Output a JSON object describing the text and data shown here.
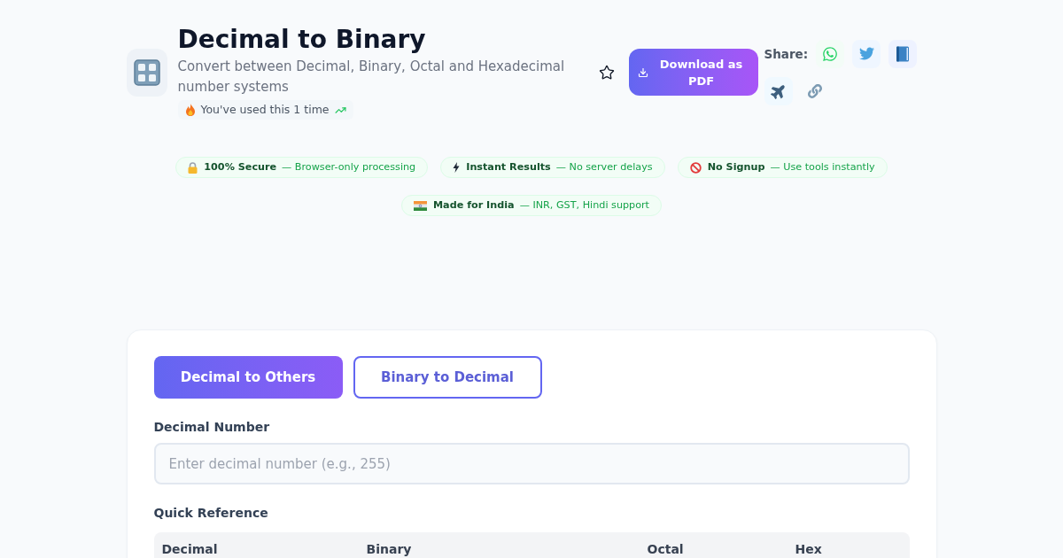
{
  "header": {
    "title": "Decimal to Binary",
    "subtitle": "Convert between Decimal, Binary, Octal and Hexadecimal number systems",
    "usage": "You've used this 1 time",
    "favorited": false,
    "download_button": "Download as PDF"
  },
  "share": {
    "label": "Share:"
  },
  "trust_badges": [
    {
      "title": "100% Secure",
      "description": "— Browser-only processing"
    },
    {
      "title": "Instant Results",
      "description": "— No server delays"
    },
    {
      "title": "No Signup",
      "description": "— Use tools instantly"
    },
    {
      "title": "Made for India",
      "description": "— INR, GST, Hindi support"
    }
  ],
  "converter": {
    "tabs": [
      {
        "label": "Decimal to Others",
        "selected": true
      },
      {
        "label": "Binary to Decimal",
        "selected": false
      }
    ],
    "input": {
      "label": "Decimal Number",
      "placeholder": "Enter decimal number (e.g., 255)"
    },
    "quick_reference": {
      "title": "Quick Reference",
      "columns": [
        "Decimal",
        "Binary",
        "Octal",
        "Hex"
      ]
    }
  }
}
